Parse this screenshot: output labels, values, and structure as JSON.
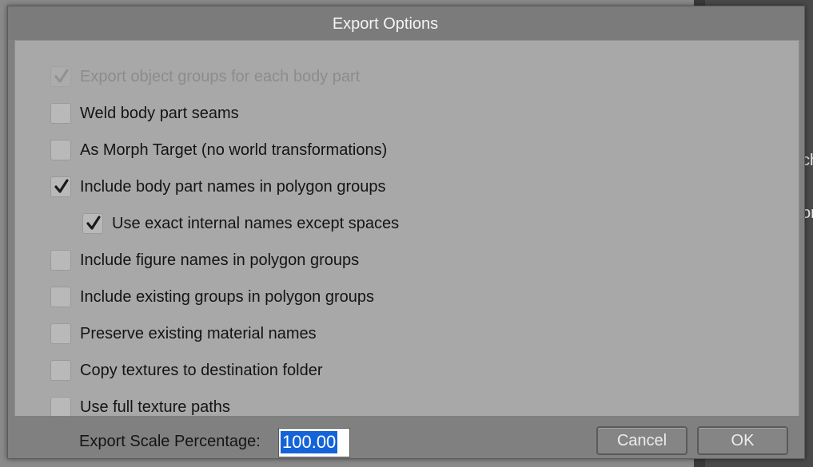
{
  "dialog": {
    "title": "Export Options"
  },
  "options": [
    {
      "label": "Export object groups for each body part",
      "checked": true,
      "disabled": true,
      "indent": 0
    },
    {
      "label": "Weld body part seams",
      "checked": false,
      "disabled": false,
      "indent": 0
    },
    {
      "label": "As Morph Target (no world transformations)",
      "checked": false,
      "disabled": false,
      "indent": 0
    },
    {
      "label": "Include body part names in polygon groups",
      "checked": true,
      "disabled": false,
      "indent": 0
    },
    {
      "label": "Use exact internal names except spaces",
      "checked": true,
      "disabled": false,
      "indent": 1
    },
    {
      "label": "Include figure names in polygon groups",
      "checked": false,
      "disabled": false,
      "indent": 0
    },
    {
      "label": "Include existing groups in polygon groups",
      "checked": false,
      "disabled": false,
      "indent": 0
    },
    {
      "label": "Preserve existing material names",
      "checked": false,
      "disabled": false,
      "indent": 0
    },
    {
      "label": "Copy textures to destination folder",
      "checked": false,
      "disabled": false,
      "indent": 0
    },
    {
      "label": "Use full texture paths",
      "checked": false,
      "disabled": false,
      "indent": 0
    }
  ],
  "footer": {
    "scale_label": "Export Scale Percentage:",
    "scale_value": "100.00",
    "cancel_label": "Cancel",
    "ok_label": "OK"
  },
  "background": {
    "fragment_1": "ch",
    "fragment_2": "or"
  },
  "colors": {
    "selection": "#1464d8",
    "panel": "#a8a8a8",
    "dialog": "#808080"
  }
}
